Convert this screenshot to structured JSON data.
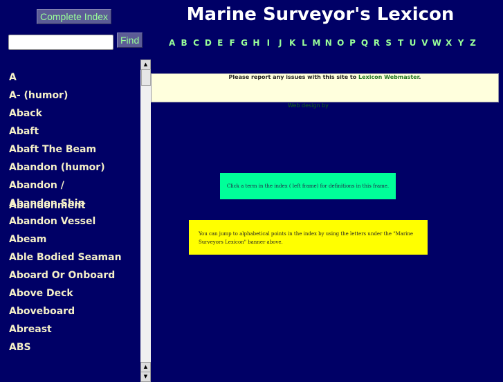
{
  "sidebar": {
    "complete_index_label": "Complete Index",
    "search_value": "",
    "find_label": "Find",
    "items": [
      "A",
      "A- (humor)",
      "Aback",
      "Abaft",
      "Abaft The Beam",
      "Abandon (humor)",
      "Abandon / Abandonment",
      "Abandon Ship",
      "Abandon Vessel",
      "Abeam",
      "Able Bodied Seaman",
      "Aboard Or Onboard",
      "Above Deck",
      "Aboveboard",
      "Abreast",
      "ABS"
    ]
  },
  "header": {
    "title": "Marine Surveyor's Lexicon",
    "letters": [
      "A",
      "B",
      "C",
      "D",
      "E",
      "F",
      "G",
      "H",
      "I",
      "J",
      "K",
      "L",
      "M",
      "N",
      "O",
      "P",
      "Q",
      "R",
      "S",
      "T",
      "U",
      "V",
      "W",
      "X",
      "Y",
      "Z"
    ]
  },
  "main": {
    "notice_text": "Please report any issues with this site to ",
    "notice_link": "Lexicon Webmaster",
    "notice_end": ".",
    "web_design": "Web design by",
    "instruction1": "Click a term in the index ( left frame) for definitions in this frame.",
    "instruction2": "You can jump to alphabetical points in the index by using the letters under the \"Marine Surveyors Lexicon\" banner above."
  },
  "colors": {
    "background": "#000066",
    "link_green": "#99ff99",
    "box1": "#00ff99",
    "box2": "#ffff00",
    "notice_bg": "#ffffdd"
  }
}
